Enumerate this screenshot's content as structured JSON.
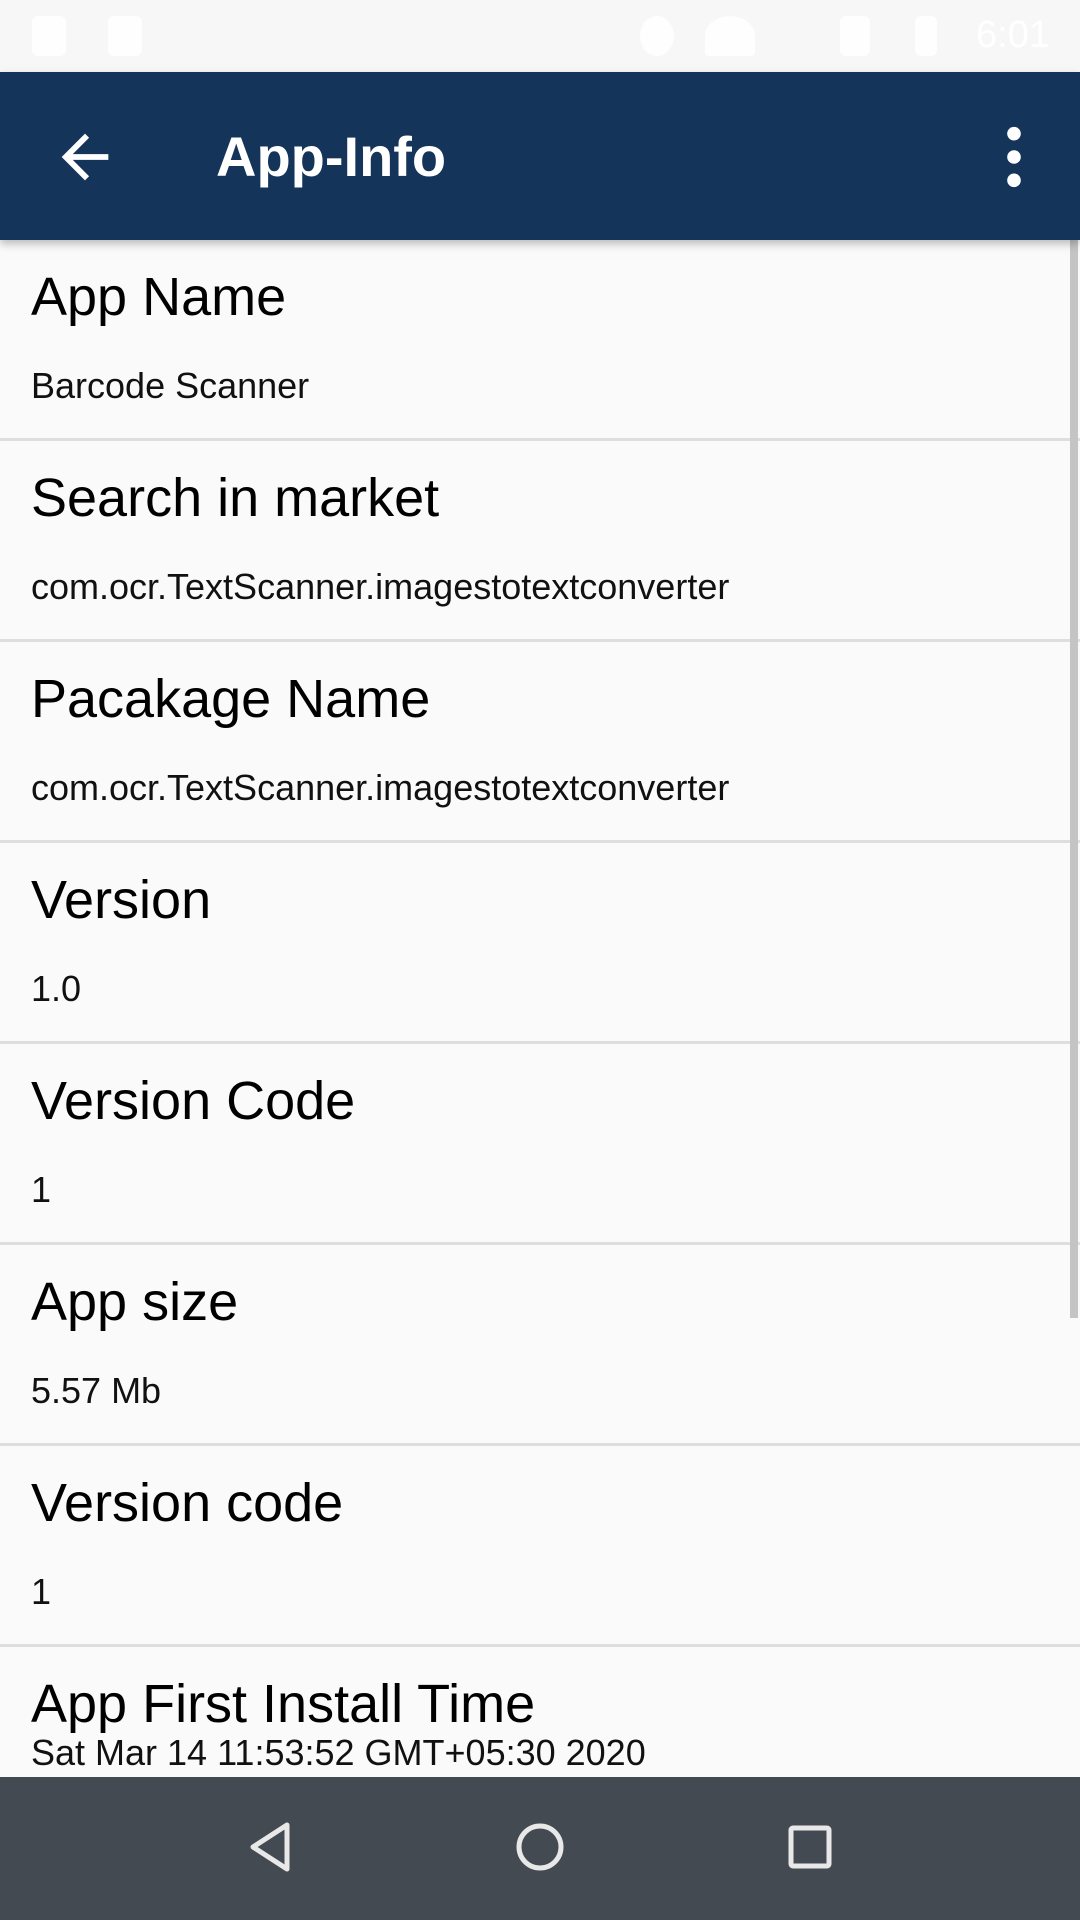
{
  "status_bar": {
    "time": "6:01"
  },
  "app_bar": {
    "title": "App-Info"
  },
  "items": [
    {
      "label": "App Name",
      "value": "Barcode Scanner"
    },
    {
      "label": "Search in market",
      "value": "com.ocr.TextScanner.imagestotextconverter"
    },
    {
      "label": "Pacakage Name",
      "value": "com.ocr.TextScanner.imagestotextconverter"
    },
    {
      "label": "Version",
      "value": "1.0"
    },
    {
      "label": "Version Code",
      "value": "1"
    },
    {
      "label": "App size",
      "value": "5.57 Mb"
    },
    {
      "label": "Version code",
      "value": "1"
    },
    {
      "label": "App First Install Time",
      "value": "Sat Mar 14 11:53:52 GMT+05:30 2020"
    }
  ],
  "colors": {
    "app_bar": "#143459",
    "nav_bar": "#434a52",
    "background": "#fafafa"
  }
}
